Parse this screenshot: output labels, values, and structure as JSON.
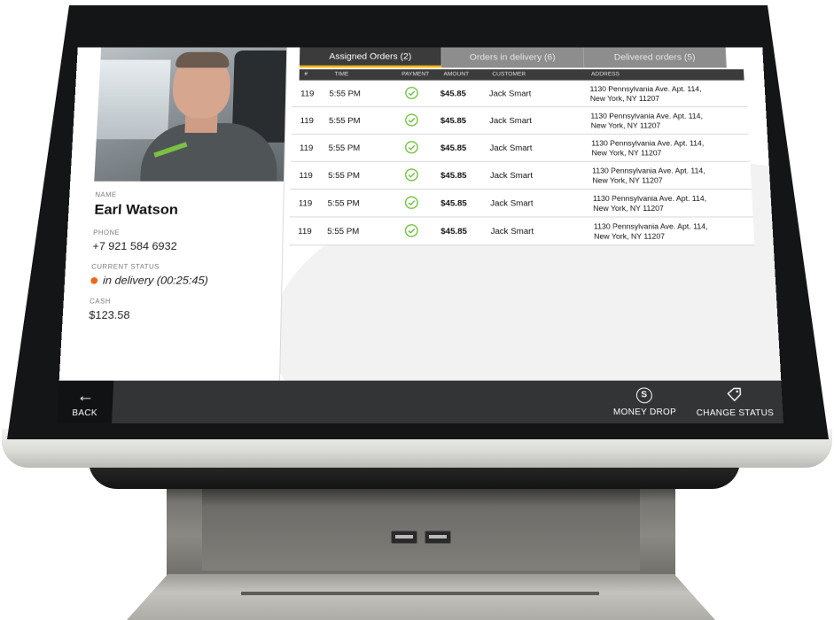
{
  "driver": {
    "name_label": "NAME",
    "name": "Earl Watson",
    "phone_label": "PHONE",
    "phone": "+7 921 584 6932",
    "status_label": "CURRENT STATUS",
    "status": "in delivery (00:25:45)",
    "status_color": "#e96a1b",
    "cash_label": "CASH",
    "cash": "$123.58"
  },
  "tabs": [
    {
      "label": "Assigned Orders (2)",
      "active": true
    },
    {
      "label": "Orders in delivery (6)",
      "active": false
    },
    {
      "label": "Delivered orders (5)",
      "active": false
    }
  ],
  "table": {
    "headers": {
      "num": "#",
      "time": "TIME",
      "payment": "PAYMENT",
      "amount": "AMOUNT",
      "customer": "CUSTOMER",
      "address": "ADDRESS"
    },
    "rows": [
      {
        "num": "119",
        "time": "5:55 PM",
        "payment_icon": "check-circle-icon",
        "amount": "$45.85",
        "customer": "Jack Smart",
        "address1": "1130 Pennsylvania Ave. Apt. 114,",
        "address2": "New York, NY 11207"
      },
      {
        "num": "119",
        "time": "5:55 PM",
        "payment_icon": "check-circle-icon",
        "amount": "$45.85",
        "customer": "Jack Smart",
        "address1": "1130 Pennsylvania Ave. Apt. 114,",
        "address2": "New York, NY 11207"
      },
      {
        "num": "119",
        "time": "5:55 PM",
        "payment_icon": "check-circle-icon",
        "amount": "$45.85",
        "customer": "Jack Smart",
        "address1": "1130 Pennsylvania Ave. Apt. 114,",
        "address2": "New York, NY 11207"
      },
      {
        "num": "119",
        "time": "5:55 PM",
        "payment_icon": "check-circle-icon",
        "amount": "$45.85",
        "customer": "Jack Smart",
        "address1": "1130 Pennsylvania Ave. Apt. 114,",
        "address2": "New York, NY 11207"
      },
      {
        "num": "119",
        "time": "5:55 PM",
        "payment_icon": "check-circle-icon",
        "amount": "$45.85",
        "customer": "Jack Smart",
        "address1": "1130 Pennsylvania Ave. Apt. 114,",
        "address2": "New York, NY 11207"
      },
      {
        "num": "119",
        "time": "5:55 PM",
        "payment_icon": "check-circle-icon",
        "amount": "$45.85",
        "customer": "Jack Smart",
        "address1": "1130 Pennsylvania Ave. Apt. 114,",
        "address2": "New York, NY 11207"
      }
    ]
  },
  "bottom_bar": {
    "back_label": "BACK",
    "back_icon": "arrow-left-icon",
    "money_drop_label": "MONEY DROP",
    "money_drop_icon": "coin-icon",
    "money_drop_glyph": "S",
    "change_status_label": "CHANGE STATUS",
    "change_status_icon": "tag-icon"
  },
  "colors": {
    "accent": "#f2b51a",
    "check": "#6cbf3a",
    "tab_active": "#3b3b3b",
    "tab_inactive": "#8d8d8d"
  }
}
